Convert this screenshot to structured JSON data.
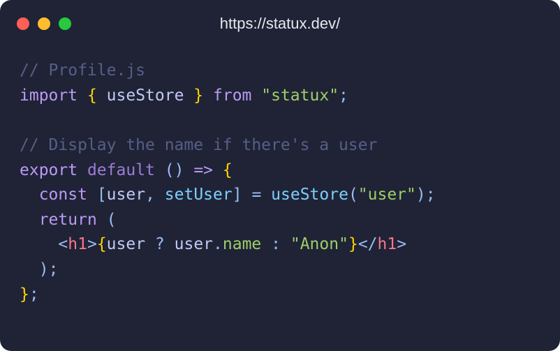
{
  "window": {
    "title": "https://statux.dev/"
  },
  "code": {
    "lines": [
      [
        {
          "t": "// Profile.js",
          "c": "tok-comment"
        }
      ],
      [
        {
          "t": "import",
          "c": "tok-keyword"
        },
        {
          "t": " ",
          "c": "tok-default"
        },
        {
          "t": "{",
          "c": "tok-brace"
        },
        {
          "t": " useStore ",
          "c": "tok-default"
        },
        {
          "t": "}",
          "c": "tok-brace"
        },
        {
          "t": " ",
          "c": "tok-default"
        },
        {
          "t": "from",
          "c": "tok-keyword"
        },
        {
          "t": " ",
          "c": "tok-default"
        },
        {
          "t": "\"statux\"",
          "c": "tok-string"
        },
        {
          "t": ";",
          "c": "tok-punct"
        }
      ],
      [],
      [
        {
          "t": "// Display the name if there's a user",
          "c": "tok-comment"
        }
      ],
      [
        {
          "t": "export",
          "c": "tok-keyword"
        },
        {
          "t": " ",
          "c": "tok-default"
        },
        {
          "t": "default",
          "c": "tok-keyword2"
        },
        {
          "t": " ",
          "c": "tok-default"
        },
        {
          "t": "()",
          "c": "tok-punct"
        },
        {
          "t": " ",
          "c": "tok-default"
        },
        {
          "t": "=>",
          "c": "tok-keyword"
        },
        {
          "t": " ",
          "c": "tok-default"
        },
        {
          "t": "{",
          "c": "tok-brace"
        }
      ],
      [
        {
          "t": "  ",
          "c": "tok-default"
        },
        {
          "t": "const",
          "c": "tok-keyword"
        },
        {
          "t": " ",
          "c": "tok-default"
        },
        {
          "t": "[",
          "c": "tok-punct"
        },
        {
          "t": "user",
          "c": "tok-default"
        },
        {
          "t": ",",
          "c": "tok-punct"
        },
        {
          "t": " ",
          "c": "tok-default"
        },
        {
          "t": "setUser",
          "c": "tok-func"
        },
        {
          "t": "]",
          "c": "tok-punct"
        },
        {
          "t": " ",
          "c": "tok-default"
        },
        {
          "t": "=",
          "c": "tok-punct"
        },
        {
          "t": " ",
          "c": "tok-default"
        },
        {
          "t": "useStore",
          "c": "tok-func"
        },
        {
          "t": "(",
          "c": "tok-punct"
        },
        {
          "t": "\"user\"",
          "c": "tok-string"
        },
        {
          "t": ")",
          "c": "tok-punct"
        },
        {
          "t": ";",
          "c": "tok-punct"
        }
      ],
      [
        {
          "t": "  ",
          "c": "tok-default"
        },
        {
          "t": "return",
          "c": "tok-keyword"
        },
        {
          "t": " ",
          "c": "tok-default"
        },
        {
          "t": "(",
          "c": "tok-punct"
        }
      ],
      [
        {
          "t": "    ",
          "c": "tok-default"
        },
        {
          "t": "<",
          "c": "tok-punct"
        },
        {
          "t": "h1",
          "c": "tok-tag"
        },
        {
          "t": ">",
          "c": "tok-punct"
        },
        {
          "t": "{",
          "c": "tok-brace"
        },
        {
          "t": "user ",
          "c": "tok-default"
        },
        {
          "t": "?",
          "c": "tok-punct"
        },
        {
          "t": " user",
          "c": "tok-default"
        },
        {
          "t": ".",
          "c": "tok-punct"
        },
        {
          "t": "name",
          "c": "tok-prop"
        },
        {
          "t": " ",
          "c": "tok-default"
        },
        {
          "t": ":",
          "c": "tok-punct"
        },
        {
          "t": " ",
          "c": "tok-default"
        },
        {
          "t": "\"Anon\"",
          "c": "tok-string"
        },
        {
          "t": "}",
          "c": "tok-brace"
        },
        {
          "t": "</",
          "c": "tok-punct"
        },
        {
          "t": "h1",
          "c": "tok-tag"
        },
        {
          "t": ">",
          "c": "tok-punct"
        }
      ],
      [
        {
          "t": "  ",
          "c": "tok-default"
        },
        {
          "t": ")",
          "c": "tok-punct"
        },
        {
          "t": ";",
          "c": "tok-punct"
        }
      ],
      [
        {
          "t": "}",
          "c": "tok-brace"
        },
        {
          "t": ";",
          "c": "tok-punct"
        }
      ]
    ]
  }
}
